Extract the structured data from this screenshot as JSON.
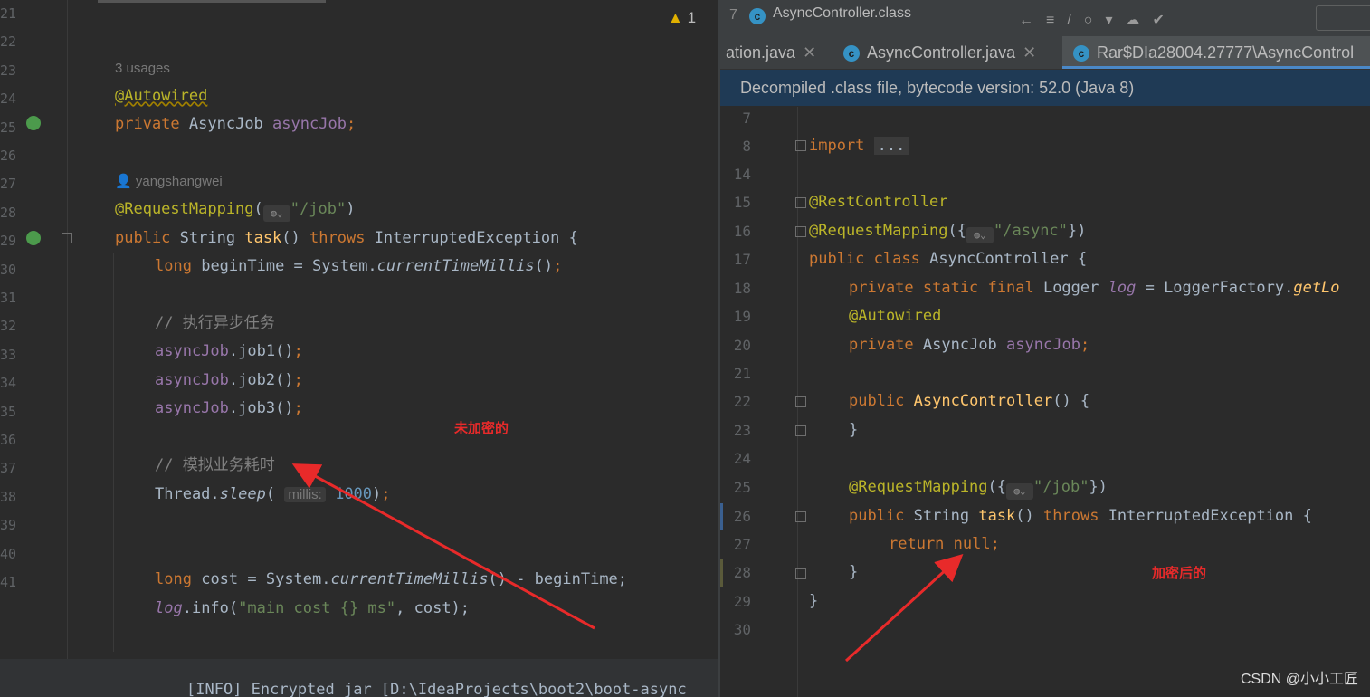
{
  "left_editor": {
    "line_numbers": [
      "21",
      "22",
      "23",
      "24",
      "25",
      "26",
      "27",
      "28",
      "29",
      "30",
      "31",
      "32",
      "33",
      "34",
      "35",
      "36",
      "37",
      "38",
      "39",
      "40",
      "41"
    ],
    "usages": "3 usages",
    "author": "yangshangwei",
    "warning_count": "1",
    "annotation_autowired": "@Autowired",
    "field_decl_kw": "private",
    "field_type": "AsyncJob",
    "field_name": "asyncJob",
    "request_mapping": "@RequestMapping",
    "request_path": "\"/job\"",
    "method_kw_public": "public",
    "method_return": "String",
    "method_name": "task",
    "throws_kw": "throws",
    "exception": "InterruptedException",
    "line_begin": "beginTime = System.",
    "current_millis": "currentTimeMillis",
    "comment_async": "// 执行异步任务",
    "job1": "job1",
    "job2": "job2",
    "job3": "job3",
    "comment_sim": "// 模拟业务耗时",
    "thread": "Thread.",
    "sleep": "sleep",
    "hint_millis": "millis:",
    "sleep_value": "1000",
    "line_cost": "cost = System.",
    "cost_tail": "() - beginTime;",
    "log": "log",
    "info_call": ".info(",
    "log_str": "\"main cost {} ms\"",
    "log_tail": ", cost);",
    "long_kw": "long"
  },
  "bottom_terminal": "[INFO] Encrypted jar [D:\\IdeaProjects\\boot2\\boot-async",
  "right_window": {
    "title": "AsyncController.class",
    "tabs": [
      {
        "label": "ation.java",
        "active": false
      },
      {
        "label": "AsyncController.java",
        "active": false
      },
      {
        "label": "Rar$DIa28004.27777\\AsyncControl",
        "active": true
      }
    ],
    "banner": "Decompiled .class file, bytecode version: 52.0 (Java 8)",
    "line_numbers": [
      "7",
      "8",
      "14",
      "15",
      "16",
      "17",
      "18",
      "19",
      "20",
      "21",
      "22",
      "23",
      "24",
      "25",
      "26",
      "27",
      "28",
      "29",
      "30"
    ],
    "import": "import",
    "import_fold": "...",
    "rest_controller": "@RestController",
    "request_mapping": "@RequestMapping",
    "async_path": "\"/async\"",
    "class_decl": "public class",
    "class_name": "AsyncController",
    "logger_decl": "private static final",
    "logger_type": "Logger",
    "log_field": "log",
    "logger_factory": "= LoggerFactory.",
    "get_logger": "getLo",
    "autowired": "@Autowired",
    "private_kw": "private",
    "async_job_type": "AsyncJob",
    "async_job_field": "asyncJob",
    "ctor_kw": "public",
    "ctor_name": "AsyncController",
    "job_path": "\"/job\"",
    "method_public": "public",
    "method_ret": "String",
    "method_name": "task",
    "throws_kw": "throws",
    "exception": "InterruptedException",
    "return_kw": "return",
    "null_kw": "null"
  },
  "annotations": {
    "unencrypted_label": "未加密的",
    "encrypted_label": "加密后的",
    "arrow_color": "#e82a2a"
  },
  "watermark": "CSDN @小小工匠"
}
